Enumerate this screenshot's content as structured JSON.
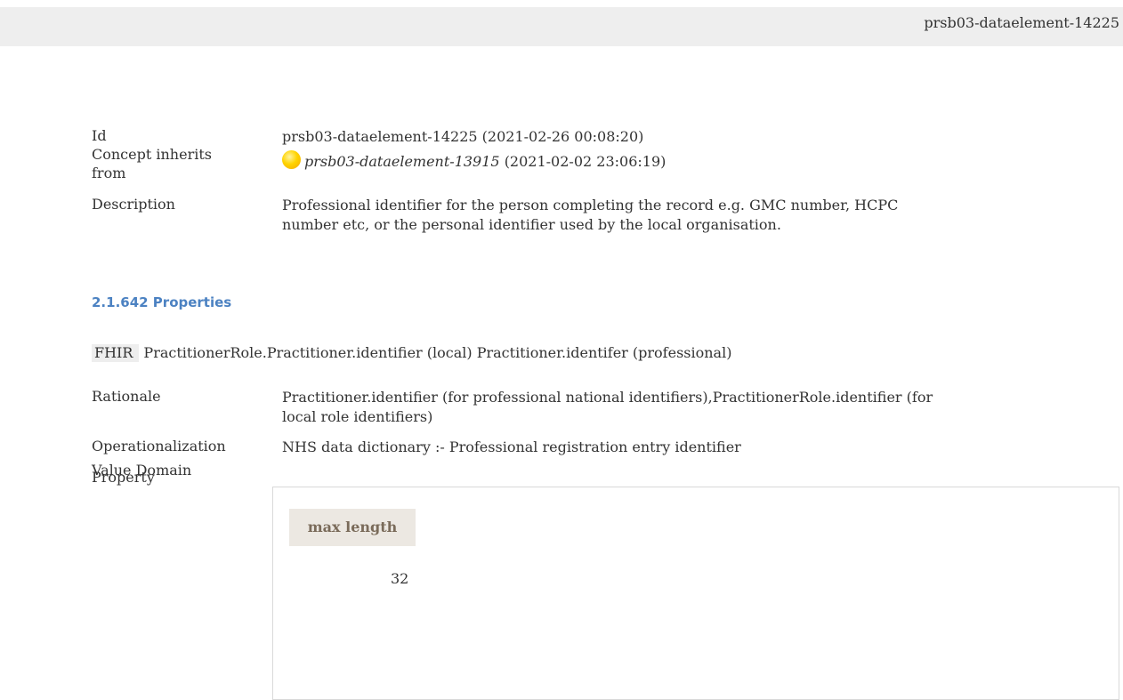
{
  "header": {
    "id_text": "prsb03-dataelement-14225"
  },
  "details": {
    "id_label": "Id",
    "id_value": "prsb03-dataelement-14225 (2021-02-26 00:08:20)",
    "inherits_label_1": "Concept inherits",
    "inherits_label_2": "from",
    "inherits_link": "prsb03-dataelement-13915",
    "inherits_date": "(2021-02-02 23:06:19)",
    "description_label": "Description",
    "description_line_1": "Professional identifier for the person completing the record e.g. GMC number, HCPC",
    "description_line_2": "number etc, or the personal identifier used by the local organisation."
  },
  "properties": {
    "title": "2.1.642 Properties",
    "fhir_tag": "FHIR",
    "fhir_value": "PractitionerRole.Practitioner.identifier (local) Practitioner.identifer (professional)",
    "rationale_label": "Rationale",
    "rationale_line_1": "Practitioner.identifier (for professional national identifiers),PractitionerRole.identifier (for",
    "rationale_line_2": "local role identifiers)",
    "operationalization_label": "Operationalization",
    "operationalization_value": "NHS data dictionary :- Professional registration entry identifier",
    "value_domain_label": "Value Domain",
    "property_label": "Property",
    "table_header": "max length",
    "table_value": "32"
  },
  "colors": {
    "section_title": "#4c82c2",
    "top_bar": "#eeeeee",
    "table_header_bg": "#ece8e2",
    "table_header_text": "#7a6b5a",
    "status_bullet": "#ffd400"
  },
  "icons": {
    "status": "yellow-status-bullet-icon"
  }
}
